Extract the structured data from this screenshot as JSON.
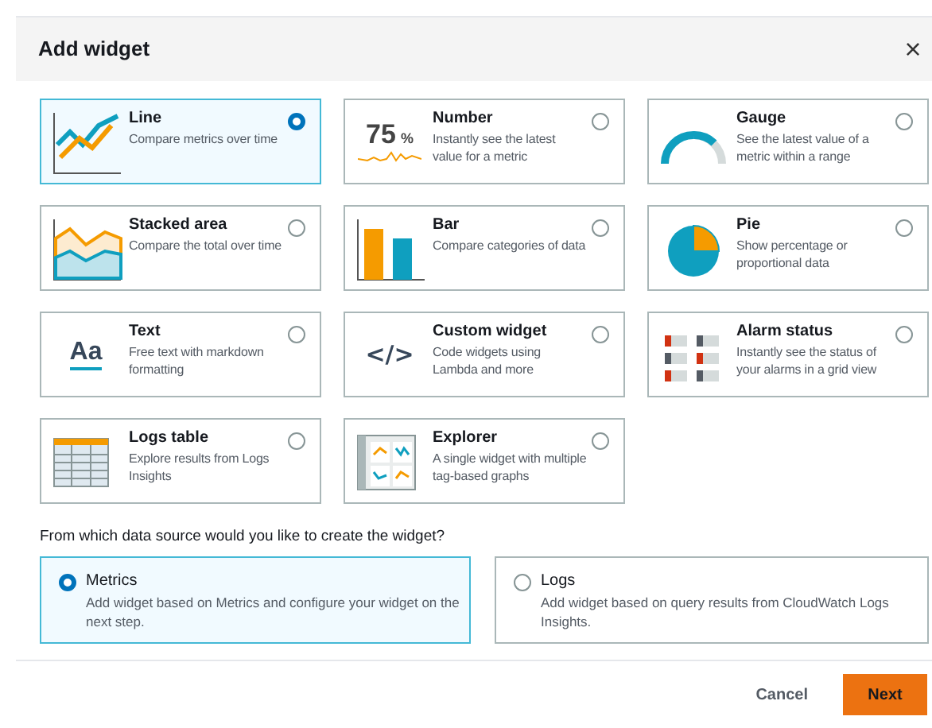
{
  "dialog": {
    "title": "Add widget",
    "close": "×"
  },
  "widgets": [
    {
      "kind": "line",
      "title": "Line",
      "description": "Compare metrics over time",
      "selected": true
    },
    {
      "kind": "number",
      "title": "Number",
      "description": "Instantly see the latest value for a metric",
      "selected": false,
      "icon_text": "75",
      "icon_unit": "%"
    },
    {
      "kind": "gauge",
      "title": "Gauge",
      "description": "See the latest value of a metric within a range",
      "selected": false
    },
    {
      "kind": "area",
      "title": "Stacked area",
      "description": "Compare the total over time",
      "selected": false
    },
    {
      "kind": "bar",
      "title": "Bar",
      "description": "Compare categories of data",
      "selected": false
    },
    {
      "kind": "pie",
      "title": "Pie",
      "description": "Show percentage or proportional data",
      "selected": false
    },
    {
      "kind": "text",
      "title": "Text",
      "description": "Free text with markdown formatting",
      "selected": false,
      "icon_text": "Aa"
    },
    {
      "kind": "code",
      "title": "Custom widget",
      "description": "Code widgets using Lambda and more",
      "selected": false,
      "icon_text": "</>"
    },
    {
      "kind": "alarm",
      "title": "Alarm status",
      "description": "Instantly see the status of your alarms in a grid view",
      "selected": false
    },
    {
      "kind": "table",
      "title": "Logs table",
      "description": "Explore results from Logs Insights",
      "selected": false
    },
    {
      "kind": "explorer",
      "title": "Explorer",
      "description": "A single widget with multiple tag-based graphs",
      "selected": false
    }
  ],
  "data_source": {
    "question": "From which data source would you like to create the widget?",
    "options": [
      {
        "title": "Metrics",
        "description": "Add widget based on Metrics and configure your widget on the next step.",
        "selected": true
      },
      {
        "title": "Logs",
        "description": "Add widget based on query results from CloudWatch Logs Insights.",
        "selected": false
      }
    ]
  },
  "buttons": {
    "cancel": "Cancel",
    "next": "Next"
  }
}
